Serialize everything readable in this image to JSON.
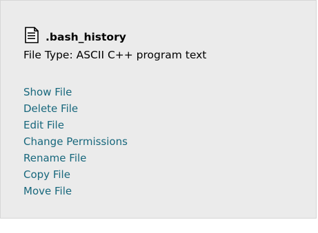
{
  "file": {
    "icon": "text-file-icon",
    "name": ".bash_history",
    "type_line": "File Type: ASCII C++ program text"
  },
  "actions": [
    {
      "label": "Show File"
    },
    {
      "label": "Delete File"
    },
    {
      "label": "Edit File"
    },
    {
      "label": "Change Permissions"
    },
    {
      "label": "Rename File"
    },
    {
      "label": "Copy File"
    },
    {
      "label": "Move File"
    }
  ],
  "colors": {
    "panel_background": "#ebebeb",
    "link": "#17677c",
    "text": "#000000"
  }
}
